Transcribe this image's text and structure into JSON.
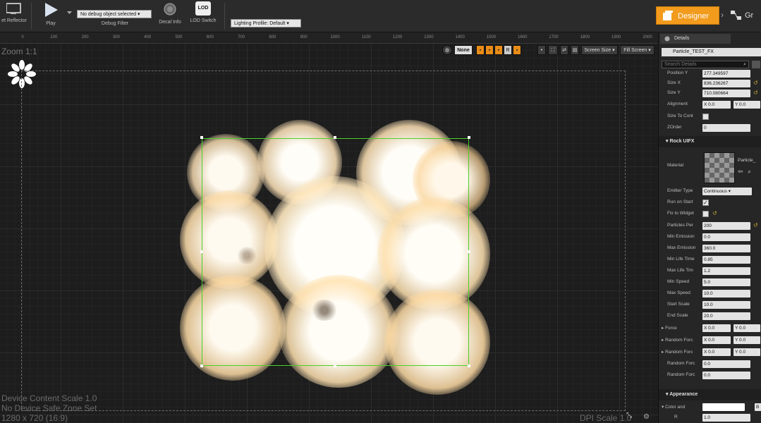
{
  "toolbar": {
    "widget_reflector": "et Reflector",
    "play": "Play",
    "debug_select": "No debug object selected",
    "debug_filter": "Debug Filter",
    "decal_info": "Decal Info",
    "lod_icon_text": "LOD",
    "lod_switch": "LOD Switch",
    "lighting_profile": "Lighting Profile: Default",
    "designer": "Designer",
    "graph": "Gr"
  },
  "ruler": {
    "ticks": [
      "0",
      "100",
      "200",
      "300",
      "400",
      "500",
      "600",
      "700",
      "800",
      "900",
      "1000",
      "1100",
      "1200",
      "1300",
      "1400",
      "1500",
      "1600",
      "1700",
      "1800",
      "1900",
      "2000"
    ]
  },
  "viewport": {
    "zoom": "Zoom 1:1",
    "none_label": "None",
    "r_label": "R",
    "screen_size": "Screen Size",
    "fill_screen": "Fill Screen",
    "device_content_scale": "Device Content Scale 1.0",
    "safe_zone": "No Device Safe Zone Set",
    "resolution": "1280 x 720 (16:9)",
    "dpi_scale": "DPI Scale 1.0"
  },
  "details": {
    "tab": "Details",
    "widget_name": "Particle_TEST_FX",
    "search_placeholder": "Search Details",
    "position_y_label": "Position Y",
    "position_y": "277.349597",
    "size_x_label": "Size X",
    "size_x": "836.236267",
    "size_y_label": "Size Y",
    "size_y": "710.080664",
    "alignment_label": "Alignment",
    "alignment_x": "X 0.0",
    "alignment_y": "Y 0.0",
    "size_to_content_label": "Size To Cont",
    "zorder_label": "ZOrder",
    "zorder": "0",
    "category_rock": "Rock UIFX",
    "material_label": "Material",
    "material_name": "Particle_",
    "emitter_type_label": "Emitter Type",
    "emitter_type": "Continuous",
    "run_on_start_label": "Run on Start",
    "fix_to_widget_label": "Fix to Widget",
    "particles_per_label": "Particles Per",
    "particles_per": "200",
    "min_emission_label": "Min Emission",
    "min_emission": "0.0",
    "max_emission_label": "Max Emission",
    "max_emission": "360.0",
    "min_life_label": "Min Life Time",
    "min_life": "0.85",
    "max_life_label": "Max Life Tim",
    "max_life": "1.2",
    "min_speed_label": "Min Speed",
    "min_speed": "5.0",
    "max_speed_label": "Max Speed",
    "max_speed": "10.0",
    "start_scale_label": "Start Scale",
    "start_scale": "10.0",
    "end_scale_label": "End Scale",
    "end_scale": "20.0",
    "force_label": "Force",
    "force_x": "X 0.0",
    "force_y": "Y 0.0",
    "random_force1_label": "Random Forc",
    "random_force1_x": "X 0.0",
    "random_force1_y": "Y 0.0",
    "random_force2_label": "Random Forc",
    "random_force2_x": "X 0.0",
    "random_force2_y": "Y 0.0",
    "random_force3_label": "Random Forc",
    "random_force3": "0.0",
    "random_force4_label": "Random Forc",
    "random_force4": "0.0",
    "category_appearance": "Appearance",
    "color_label": "Color and",
    "color_r_label": "R",
    "color_r": "1.0",
    "btn_label": "B"
  },
  "colors": {
    "accent": "#f29b1d",
    "selection": "#4ad12a",
    "particle": "#fff3dc"
  }
}
